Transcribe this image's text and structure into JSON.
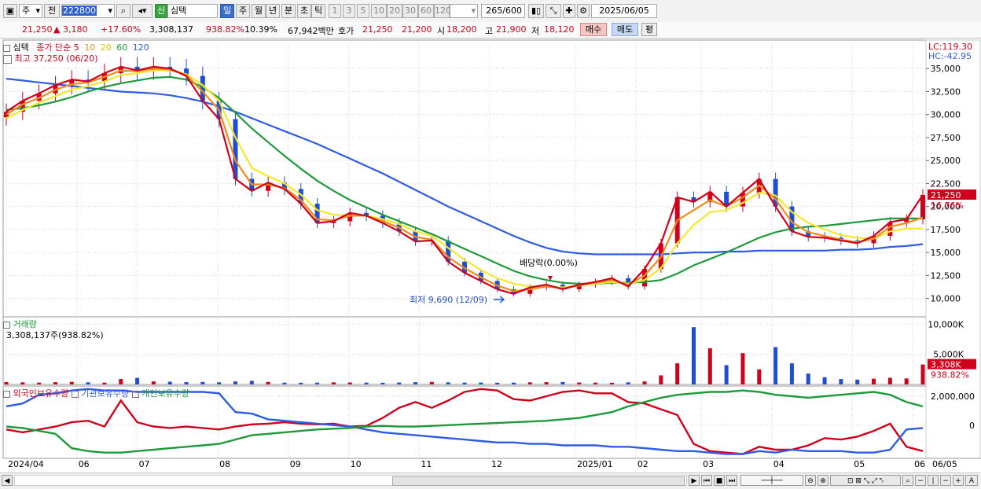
{
  "toolbar": {
    "period": "주",
    "prev": "전",
    "code": "222800",
    "sin": "신",
    "name": "심텍",
    "day": "일",
    "week": "주",
    "month": "월",
    "year": "년",
    "min": "분",
    "sec": "초",
    "tick": "틱",
    "nums": [
      "1",
      "3",
      "5",
      "10",
      "20",
      "30",
      "60",
      "120"
    ],
    "count": "265",
    "total": "/600",
    "date": "2025/06/05"
  },
  "quote": {
    "price": "21,250",
    "change": "▲   3,180",
    "change_pct": "+17.60%",
    "volume": "3,308,137",
    "vol_pct": "938.82%",
    "turnover": "10.39%",
    "amount": "67,942백만",
    "hoga_label": "호가",
    "hoga1": "21,250",
    "hoga2": "21,200",
    "open_label": "시",
    "open": "18,200",
    "high_label": "고",
    "high": "21,900",
    "low_label": "저",
    "low": "18,120",
    "buy": "매수",
    "sell": "매도",
    "eval": "평"
  },
  "icons": {
    "search": "search-icon",
    "speaker": "speaker-icon",
    "settings": "gear-icon",
    "candle": "candle-icon"
  },
  "colors": {
    "candle_up": "#d0021b",
    "candle_down": "#1f4fd1",
    "ma5": "#d0021b",
    "ma10": "#f08a1c",
    "ma20": "#f5e82a",
    "ma60": "#1e9a3a",
    "ma120": "#2e5ce6",
    "foreign": "#d0021b",
    "inst": "#2e5ce6",
    "indiv": "#1e9a3a"
  },
  "chart_data": [
    {
      "type": "line",
      "panel": "price",
      "title": "심텍",
      "legend_title": "종가 단순",
      "legend_ma": [
        "5",
        "10",
        "20",
        "60",
        "120"
      ],
      "lc": "LC:119.30",
      "hc": "HC:-42.95",
      "y_ticks": [
        "35,000",
        "32,500",
        "30,000",
        "27,500",
        "25,000",
        "22,500",
        "20,000",
        "17,500",
        "15,000",
        "12,500",
        "10,000"
      ],
      "ylim": [
        8000,
        37500
      ],
      "x_labels": [
        "2024/04",
        "06",
        "07",
        "08",
        "09",
        "10",
        "11",
        "12",
        "2025/01",
        "02",
        "03",
        "04",
        "05",
        "06"
      ],
      "x_right_label": "06/05",
      "annotations": {
        "high": "최고 37,250 (06/20)",
        "low": "최저 9,690 (12/09)",
        "dividend": "배당락(0.00%)"
      },
      "last_price": "21,250",
      "last_pct": "16.76%",
      "series": [
        {
          "name": "5",
          "values": [
            30300,
            31500,
            32300,
            33200,
            33800,
            33600,
            34500,
            35200,
            34800,
            35200,
            35000,
            34200,
            31500,
            29500,
            23000,
            21700,
            22600,
            21900,
            20300,
            18200,
            18400,
            19300,
            19000,
            18200,
            17300,
            16200,
            16300,
            14000,
            12800,
            11900,
            11000,
            10500,
            11200,
            11500,
            11000,
            11500,
            11800,
            12200,
            11300,
            13200,
            16000,
            21000,
            20500,
            21600,
            20000,
            21500,
            23000,
            20000,
            17300,
            16700,
            16600,
            16300,
            16000,
            16800,
            18300,
            18600,
            21250
          ]
        },
        {
          "name": "10",
          "values": [
            30000,
            31100,
            31800,
            32700,
            33300,
            33500,
            34100,
            34800,
            34700,
            35000,
            34900,
            34300,
            32500,
            30500,
            25000,
            22400,
            22400,
            22000,
            20700,
            18600,
            18500,
            19000,
            19000,
            18400,
            17700,
            16700,
            16400,
            14500,
            13300,
            12300,
            11400,
            10800,
            11000,
            11300,
            11100,
            11400,
            11700,
            12000,
            11500,
            12500,
            14500,
            18500,
            19600,
            20700,
            20000,
            21000,
            22300,
            20800,
            18300,
            17200,
            16800,
            16400,
            16100,
            16500,
            17800,
            18200,
            18800
          ]
        },
        {
          "name": "20",
          "values": [
            29600,
            30500,
            31300,
            32000,
            32700,
            33100,
            33600,
            34300,
            34500,
            34800,
            34800,
            34400,
            33200,
            31500,
            27500,
            24200,
            23300,
            22500,
            21300,
            19600,
            19100,
            19000,
            19000,
            18600,
            18100,
            17300,
            16800,
            15500,
            14200,
            13100,
            12200,
            11600,
            11300,
            11300,
            11200,
            11400,
            11600,
            11800,
            11600,
            12000,
            13300,
            16000,
            18000,
            19400,
            19600,
            20400,
            21500,
            21200,
            19400,
            18200,
            17500,
            16900,
            16600,
            16500,
            17300,
            17600,
            17600
          ]
        },
        {
          "name": "60",
          "values": [
            30500,
            30700,
            31000,
            31400,
            31900,
            32500,
            33000,
            33400,
            33700,
            34000,
            34100,
            33800,
            33000,
            31800,
            30200,
            28500,
            27000,
            25500,
            24100,
            22800,
            21700,
            20700,
            19900,
            19100,
            18400,
            17700,
            17000,
            16200,
            15400,
            14600,
            13800,
            13000,
            12400,
            12000,
            11700,
            11600,
            11600,
            11700,
            11700,
            11800,
            12000,
            12700,
            13600,
            14300,
            15000,
            15800,
            16600,
            17200,
            17600,
            17800,
            17900,
            18100,
            18300,
            18500,
            18700,
            18700,
            18700
          ]
        },
        {
          "name": "120",
          "values": [
            33900,
            33700,
            33500,
            33300,
            33100,
            32900,
            32700,
            32500,
            32400,
            32300,
            32100,
            31800,
            31400,
            30900,
            30300,
            29600,
            28900,
            28200,
            27500,
            26800,
            26000,
            25200,
            24400,
            23600,
            22700,
            21800,
            20900,
            20000,
            19200,
            18400,
            17600,
            16800,
            16100,
            15500,
            15100,
            14900,
            14800,
            14800,
            14800,
            14800,
            14800,
            14900,
            15000,
            15000,
            15100,
            15100,
            15200,
            15200,
            15200,
            15200,
            15200,
            15300,
            15300,
            15400,
            15600,
            15700,
            15900
          ]
        }
      ]
    },
    {
      "type": "bar",
      "panel": "volume",
      "title": "거래량",
      "value_label": "3,308,137주(938.82%)",
      "y_ticks": [
        "10,000K",
        "5,000K"
      ],
      "ylim": [
        0,
        10700
      ],
      "last_value": "3,308K",
      "last_pct": "938.82%",
      "values": [
        400,
        350,
        300,
        380,
        420,
        350,
        300,
        900,
        1100,
        500,
        450,
        380,
        420,
        350,
        500,
        600,
        420,
        300,
        280,
        300,
        350,
        320,
        300,
        280,
        320,
        380,
        420,
        350,
        300,
        320,
        280,
        300,
        350,
        380,
        400,
        320,
        300,
        280,
        350,
        500,
        1500,
        3500,
        9500,
        6000,
        3200,
        5200,
        2500,
        6200,
        3500,
        1800,
        1200,
        900,
        800,
        950,
        1100,
        1000,
        3308
      ]
    },
    {
      "type": "line",
      "panel": "holdings",
      "legend": [
        "외국인보유수량",
        "기관보유수량",
        "개인보유수량"
      ],
      "y_ticks": [
        "2,000,000",
        "0"
      ],
      "ylim": [
        -2300000,
        2600000
      ],
      "series": [
        {
          "name": "외국인보유수량",
          "values": [
            -300000,
            -500000,
            -300000,
            -100000,
            200000,
            300000,
            -100000,
            1700000,
            200000,
            -100000,
            -200000,
            -100000,
            -200000,
            -300000,
            -100000,
            50000,
            100000,
            200000,
            100000,
            50000,
            100000,
            -100000,
            -50000,
            500000,
            1200000,
            1600000,
            1200000,
            1700000,
            2300000,
            2500000,
            2400000,
            1800000,
            1700000,
            2000000,
            2300000,
            2400000,
            2200000,
            2200000,
            1600000,
            1500000,
            1100000,
            700000,
            -1300000,
            -1800000,
            -1900000,
            -2000000,
            -1500000,
            -1700000,
            -1700000,
            -1400000,
            -900000,
            -1000000,
            -800000,
            -400000,
            100000,
            -1500000,
            -1800000
          ]
        },
        {
          "name": "기관보유수량",
          "values": [
            1300000,
            1500000,
            2100000,
            2200000,
            2400000,
            2500000,
            2400000,
            2400000,
            2300000,
            2300000,
            2300000,
            2300000,
            2300000,
            2200000,
            900000,
            800000,
            400000,
            300000,
            200000,
            100000,
            0,
            -100000,
            -300000,
            -500000,
            -600000,
            -700000,
            -800000,
            -900000,
            -1000000,
            -1100000,
            -1200000,
            -1200000,
            -1300000,
            -1300000,
            -1400000,
            -1400000,
            -1400000,
            -1500000,
            -1500000,
            -1600000,
            -1700000,
            -1800000,
            -1800000,
            -1900000,
            -2000000,
            -2000000,
            -1800000,
            -1900000,
            -1700000,
            -1800000,
            -1800000,
            -1800000,
            -1900000,
            -1900000,
            -1700000,
            -300000,
            -200000
          ]
        },
        {
          "name": "개인보유수량",
          "values": [
            -100000,
            -200000,
            -400000,
            -600000,
            -1600000,
            -1800000,
            -1900000,
            -1900000,
            -1800000,
            -1700000,
            -1600000,
            -1500000,
            -1400000,
            -1300000,
            -1000000,
            -700000,
            -600000,
            -500000,
            -400000,
            -300000,
            -250000,
            -200000,
            -100000,
            -50000,
            -100000,
            -100000,
            -50000,
            0,
            50000,
            100000,
            150000,
            200000,
            250000,
            300000,
            400000,
            500000,
            700000,
            900000,
            1300000,
            1600000,
            1900000,
            2100000,
            2200000,
            2300000,
            2300000,
            2400000,
            2300000,
            2100000,
            2000000,
            1900000,
            2000000,
            2100000,
            2200000,
            2300000,
            2100000,
            1600000,
            1300000
          ]
        }
      ]
    }
  ]
}
